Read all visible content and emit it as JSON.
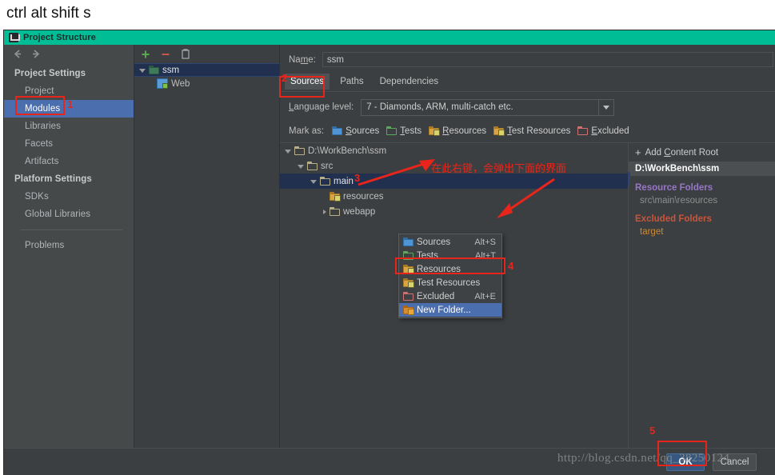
{
  "caption": "ctrl alt shift s",
  "window": {
    "title": "Project Structure",
    "icon": "intellij-idea-icon"
  },
  "sidebar": {
    "nav_back_icon": "arrow-left-icon",
    "nav_forward_icon": "arrow-right-icon",
    "groups": [
      {
        "label": "Project Settings",
        "items": [
          {
            "label": "Project",
            "selected": false
          },
          {
            "label": "Modules",
            "selected": true
          },
          {
            "label": "Libraries",
            "selected": false
          },
          {
            "label": "Facets",
            "selected": false
          },
          {
            "label": "Artifacts",
            "selected": false
          }
        ]
      },
      {
        "label": "Platform Settings",
        "items": [
          {
            "label": "SDKs",
            "selected": false
          },
          {
            "label": "Global Libraries",
            "selected": false
          }
        ]
      }
    ],
    "problems": "Problems"
  },
  "modules": {
    "toolbar": {
      "add_icon": "plus-icon",
      "remove_icon": "minus-icon",
      "copy_icon": "copy-icon"
    },
    "tree": [
      {
        "label": "ssm",
        "icon": "module-folder-icon",
        "selected": true,
        "depth": 0,
        "expanded": true
      },
      {
        "label": "Web",
        "icon": "web-facet-icon",
        "selected": false,
        "depth": 1,
        "expanded": null
      }
    ]
  },
  "main": {
    "name_label": "Name:",
    "name_value": "ssm",
    "tabs": [
      {
        "label": "Sources",
        "active": true
      },
      {
        "label": "Paths",
        "active": false
      },
      {
        "label": "Dependencies",
        "active": false
      }
    ],
    "language_level_label": "Language level:",
    "language_level_value": "7 - Diamonds, ARM, multi-catch etc.",
    "mark_as_label": "Mark as:",
    "mark_as": [
      {
        "label": "Sources",
        "mnemonic": "S",
        "rest": "ources",
        "icon": "blue-folder-icon"
      },
      {
        "label": "Tests",
        "mnemonic": "T",
        "rest": "ests",
        "icon": "green-folder-icon"
      },
      {
        "label": "Resources",
        "mnemonic": "R",
        "rest": "esources",
        "icon": "yellow-resource-folder-icon"
      },
      {
        "label": "Test Resources",
        "mnemonic": "T",
        "rest": "est Resources",
        "icon": "yellow-test-resource-folder-icon"
      },
      {
        "label": "Excluded",
        "mnemonic": "E",
        "rest": "xcluded",
        "icon": "red-folder-icon"
      }
    ],
    "content_tree": [
      {
        "label": "D:\\WorkBench\\ssm",
        "depth": 0,
        "expanded": true,
        "selected": false,
        "icon": "plain-folder-icon"
      },
      {
        "label": "src",
        "depth": 1,
        "expanded": true,
        "selected": false,
        "icon": "plain-folder-icon"
      },
      {
        "label": "main",
        "depth": 2,
        "expanded": true,
        "selected": true,
        "icon": "plain-folder-icon"
      },
      {
        "label": "resources",
        "depth": 3,
        "expanded": null,
        "selected": false,
        "icon": "yellow-resource-folder-icon"
      },
      {
        "label": "webapp",
        "depth": 3,
        "expanded": false,
        "selected": false,
        "icon": "plain-folder-icon"
      }
    ],
    "context_menu": [
      {
        "label": "Sources",
        "shortcut": "Alt+S",
        "icon": "blue-folder-icon",
        "highlight": false
      },
      {
        "label": "Tests",
        "shortcut": "Alt+T",
        "icon": "green-folder-icon",
        "highlight": false
      },
      {
        "label": "Resources",
        "shortcut": "",
        "icon": "yellow-resource-folder-icon",
        "highlight": false
      },
      {
        "label": "Test Resources",
        "shortcut": "",
        "icon": "yellow-test-resource-folder-icon",
        "highlight": false
      },
      {
        "label": "Excluded",
        "shortcut": "Alt+E",
        "icon": "red-folder-icon",
        "highlight": false
      },
      {
        "label": "New Folder...",
        "shortcut": "",
        "icon": "new-folder-icon",
        "highlight": true
      }
    ],
    "roots_panel": {
      "add_content_root": "Add Content Root",
      "content_root_path": "D:\\WorkBench\\ssm",
      "resource_folders_title": "Resource Folders",
      "resource_folders_value": "src\\main\\resources",
      "excluded_folders_title": "Excluded Folders",
      "excluded_folders_value": "target"
    }
  },
  "footer": {
    "ok_label": "OK",
    "cancel_label": "Cancel"
  },
  "annotations": {
    "num1": "1",
    "num2": "2",
    "num3": "3",
    "num4": "4",
    "num5": "5",
    "note": "在此右键，会弹出下面的界面"
  },
  "watermark": "http://blog.csdn.net/qq_38250124",
  "colors": {
    "titlebar": "#00bd96",
    "dialog_bg": "#3c3f41",
    "sidebar_bg": "#45494a",
    "selection_blue": "#4b6eaf",
    "tree_selection": "#21304e",
    "annotation_red": "#e8251b",
    "resource_purple": "#9876c9",
    "excluded_red": "#c7553c",
    "excluded_value_orange": "#c98a37",
    "ok_button": "#365880"
  }
}
